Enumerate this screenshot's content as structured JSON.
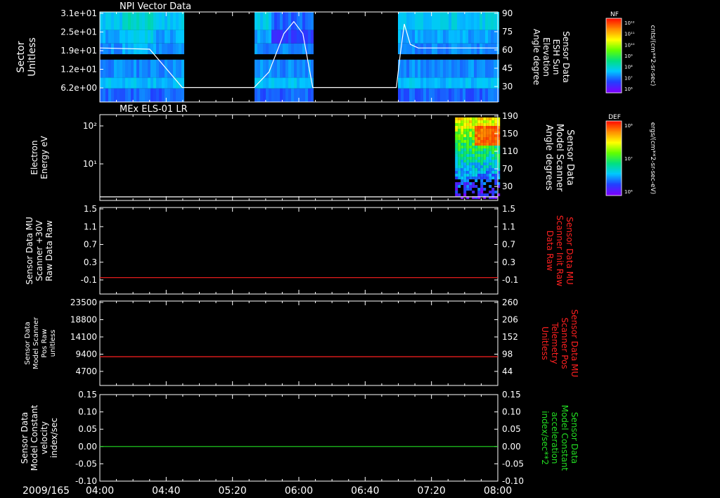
{
  "colors": {
    "background": "#000000",
    "text": "#ffffff",
    "red": "#ff2020",
    "green": "#22dd22",
    "colorbar": [
      "#7a00ff",
      "#2040ff",
      "#00c8ff",
      "#00e080",
      "#60ff00",
      "#ffff00",
      "#ff9000",
      "#ff1000"
    ]
  },
  "chart_data": [
    {
      "type": "heatmap",
      "title": "NPI Vector Data",
      "ylabel": "Sector Unitless",
      "y_ticks": [
        "3.1e+01",
        "2.5e+01",
        "1.9e+01",
        "1.2e+01",
        "6.2e+00"
      ],
      "y2label": "Sensor Data ESH Sun Elevation Angle degree",
      "y2_ticks": [
        "90",
        "75",
        "60",
        "45",
        "30"
      ],
      "y2lim": [
        15,
        90
      ],
      "colorbar": {
        "label": "NF",
        "units": "cnts/(cm**2-sr-sec)",
        "ticks": [
          "10¹²",
          "10¹¹",
          "10¹⁰",
          "10⁹",
          "10⁸",
          "10⁷",
          "10⁶"
        ]
      },
      "data_gaps_hours": [
        [
          4.83,
          5.55
        ],
        [
          6.14,
          6.98
        ]
      ],
      "overlay_line": {
        "x_hours": [
          4.0,
          4.5,
          4.83,
          5.55,
          5.7,
          5.85,
          5.95,
          6.04,
          6.14,
          6.98,
          7.02,
          7.06,
          7.12,
          7.2,
          8.0
        ],
        "values": [
          60,
          59,
          27,
          27,
          40,
          72,
          82,
          72,
          27,
          27,
          55,
          80,
          63,
          60,
          60
        ]
      }
    },
    {
      "type": "heatmap",
      "title": "MEx ELS-01 LR",
      "ylabel": "Electron Energy eV",
      "y_ticks": [
        "10²",
        "10¹"
      ],
      "y2label": "Sensor Data Model Scanner Angle degrees",
      "y2_ticks": [
        "190",
        "150",
        "110",
        "70",
        "30"
      ],
      "y2lim": [
        0,
        190
      ],
      "colorbar": {
        "label": "DEF",
        "units": "ergs/(cm**2-sr-sec-eV)",
        "ticks": [
          "10⁸",
          "10⁷",
          "10⁶"
        ]
      },
      "data_start_hours": 7.57,
      "overlay_line": {
        "x_hours": [
          4.0,
          8.0
        ],
        "values": [
          8,
          8
        ]
      }
    },
    {
      "type": "line",
      "ylabel": "Sensor Data MU Scanner +30V Raw Data Raw",
      "y_ticks": [
        "1.5",
        "1.1",
        "0.7",
        "0.3",
        "-0.1"
      ],
      "ylim": [
        -0.35,
        1.5
      ],
      "y2label": "Sensor Data MU Scanner Init Raw Data Raw",
      "y2_ticks": [
        "1.5",
        "1.1",
        "0.7",
        "0.3",
        "-0.1"
      ],
      "series": [
        {
          "x_hours": [
            4.0,
            8.0
          ],
          "values": [
            0.0,
            0.0
          ],
          "color": "#ff2020"
        }
      ]
    },
    {
      "type": "line",
      "ylabel": "Sensor Data Model Scanner Pos Raw unitless",
      "y_ticks": [
        "23500",
        "18800",
        "14100",
        "9400",
        "4700"
      ],
      "ylim": [
        0,
        23500
      ],
      "y2label": "Sensor Data MU Scanner Pos Telemetry Unitless",
      "y2_ticks": [
        "260",
        "206",
        "152",
        "98",
        "44"
      ],
      "series": [
        {
          "x_hours": [
            4.0,
            8.0
          ],
          "values": [
            8000,
            8000
          ],
          "color": "#ff2020"
        }
      ]
    },
    {
      "type": "line",
      "ylabel": "Sensor Data Model Constant velocity index/sec",
      "y_ticks": [
        "0.15",
        "0.10",
        "0.05",
        "0.00",
        "-0.05",
        "-0.10"
      ],
      "ylim": [
        -0.1,
        0.15
      ],
      "y2label": "Sensor Data Model Constant acceleration index/sec**2",
      "y2_ticks": [
        "0.15",
        "0.10",
        "0.05",
        "0.00",
        "-0.05",
        "-0.10"
      ],
      "series": [
        {
          "x_hours": [
            4.0,
            8.0
          ],
          "values": [
            0.0,
            0.0
          ],
          "color": "#22dd22"
        }
      ]
    }
  ],
  "x_axis": {
    "date": "2009/165",
    "ticks": [
      "04:00",
      "04:40",
      "05:20",
      "06:00",
      "06:40",
      "07:20",
      "08:00"
    ],
    "xlim_hours": [
      4.0,
      8.0
    ]
  }
}
